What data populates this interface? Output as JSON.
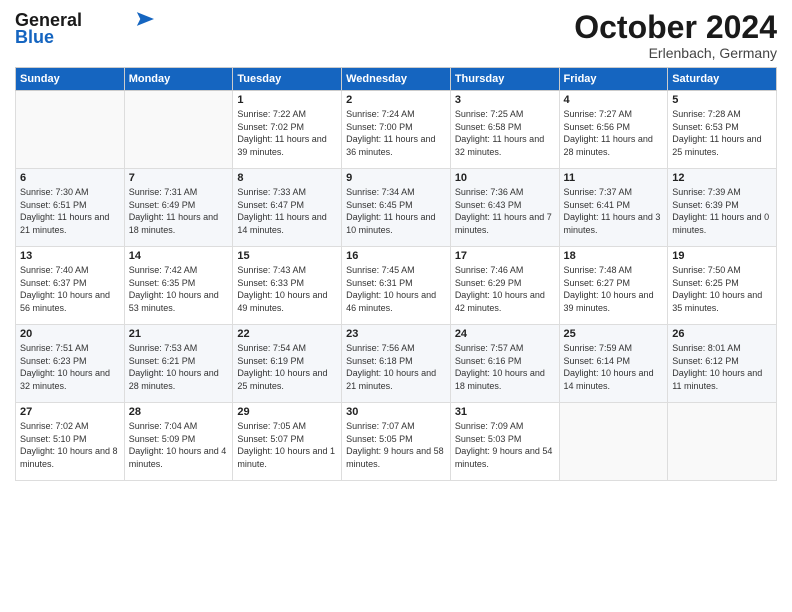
{
  "header": {
    "logo_line1": "General",
    "logo_line2": "Blue",
    "month_title": "October 2024",
    "location": "Erlenbach, Germany"
  },
  "weekdays": [
    "Sunday",
    "Monday",
    "Tuesday",
    "Wednesday",
    "Thursday",
    "Friday",
    "Saturday"
  ],
  "weeks": [
    [
      {
        "day": "",
        "content": ""
      },
      {
        "day": "",
        "content": ""
      },
      {
        "day": "1",
        "content": "Sunrise: 7:22 AM\nSunset: 7:02 PM\nDaylight: 11 hours and 39 minutes."
      },
      {
        "day": "2",
        "content": "Sunrise: 7:24 AM\nSunset: 7:00 PM\nDaylight: 11 hours and 36 minutes."
      },
      {
        "day": "3",
        "content": "Sunrise: 7:25 AM\nSunset: 6:58 PM\nDaylight: 11 hours and 32 minutes."
      },
      {
        "day": "4",
        "content": "Sunrise: 7:27 AM\nSunset: 6:56 PM\nDaylight: 11 hours and 28 minutes."
      },
      {
        "day": "5",
        "content": "Sunrise: 7:28 AM\nSunset: 6:53 PM\nDaylight: 11 hours and 25 minutes."
      }
    ],
    [
      {
        "day": "6",
        "content": "Sunrise: 7:30 AM\nSunset: 6:51 PM\nDaylight: 11 hours and 21 minutes."
      },
      {
        "day": "7",
        "content": "Sunrise: 7:31 AM\nSunset: 6:49 PM\nDaylight: 11 hours and 18 minutes."
      },
      {
        "day": "8",
        "content": "Sunrise: 7:33 AM\nSunset: 6:47 PM\nDaylight: 11 hours and 14 minutes."
      },
      {
        "day": "9",
        "content": "Sunrise: 7:34 AM\nSunset: 6:45 PM\nDaylight: 11 hours and 10 minutes."
      },
      {
        "day": "10",
        "content": "Sunrise: 7:36 AM\nSunset: 6:43 PM\nDaylight: 11 hours and 7 minutes."
      },
      {
        "day": "11",
        "content": "Sunrise: 7:37 AM\nSunset: 6:41 PM\nDaylight: 11 hours and 3 minutes."
      },
      {
        "day": "12",
        "content": "Sunrise: 7:39 AM\nSunset: 6:39 PM\nDaylight: 11 hours and 0 minutes."
      }
    ],
    [
      {
        "day": "13",
        "content": "Sunrise: 7:40 AM\nSunset: 6:37 PM\nDaylight: 10 hours and 56 minutes."
      },
      {
        "day": "14",
        "content": "Sunrise: 7:42 AM\nSunset: 6:35 PM\nDaylight: 10 hours and 53 minutes."
      },
      {
        "day": "15",
        "content": "Sunrise: 7:43 AM\nSunset: 6:33 PM\nDaylight: 10 hours and 49 minutes."
      },
      {
        "day": "16",
        "content": "Sunrise: 7:45 AM\nSunset: 6:31 PM\nDaylight: 10 hours and 46 minutes."
      },
      {
        "day": "17",
        "content": "Sunrise: 7:46 AM\nSunset: 6:29 PM\nDaylight: 10 hours and 42 minutes."
      },
      {
        "day": "18",
        "content": "Sunrise: 7:48 AM\nSunset: 6:27 PM\nDaylight: 10 hours and 39 minutes."
      },
      {
        "day": "19",
        "content": "Sunrise: 7:50 AM\nSunset: 6:25 PM\nDaylight: 10 hours and 35 minutes."
      }
    ],
    [
      {
        "day": "20",
        "content": "Sunrise: 7:51 AM\nSunset: 6:23 PM\nDaylight: 10 hours and 32 minutes."
      },
      {
        "day": "21",
        "content": "Sunrise: 7:53 AM\nSunset: 6:21 PM\nDaylight: 10 hours and 28 minutes."
      },
      {
        "day": "22",
        "content": "Sunrise: 7:54 AM\nSunset: 6:19 PM\nDaylight: 10 hours and 25 minutes."
      },
      {
        "day": "23",
        "content": "Sunrise: 7:56 AM\nSunset: 6:18 PM\nDaylight: 10 hours and 21 minutes."
      },
      {
        "day": "24",
        "content": "Sunrise: 7:57 AM\nSunset: 6:16 PM\nDaylight: 10 hours and 18 minutes."
      },
      {
        "day": "25",
        "content": "Sunrise: 7:59 AM\nSunset: 6:14 PM\nDaylight: 10 hours and 14 minutes."
      },
      {
        "day": "26",
        "content": "Sunrise: 8:01 AM\nSunset: 6:12 PM\nDaylight: 10 hours and 11 minutes."
      }
    ],
    [
      {
        "day": "27",
        "content": "Sunrise: 7:02 AM\nSunset: 5:10 PM\nDaylight: 10 hours and 8 minutes."
      },
      {
        "day": "28",
        "content": "Sunrise: 7:04 AM\nSunset: 5:09 PM\nDaylight: 10 hours and 4 minutes."
      },
      {
        "day": "29",
        "content": "Sunrise: 7:05 AM\nSunset: 5:07 PM\nDaylight: 10 hours and 1 minute."
      },
      {
        "day": "30",
        "content": "Sunrise: 7:07 AM\nSunset: 5:05 PM\nDaylight: 9 hours and 58 minutes."
      },
      {
        "day": "31",
        "content": "Sunrise: 7:09 AM\nSunset: 5:03 PM\nDaylight: 9 hours and 54 minutes."
      },
      {
        "day": "",
        "content": ""
      },
      {
        "day": "",
        "content": ""
      }
    ]
  ]
}
